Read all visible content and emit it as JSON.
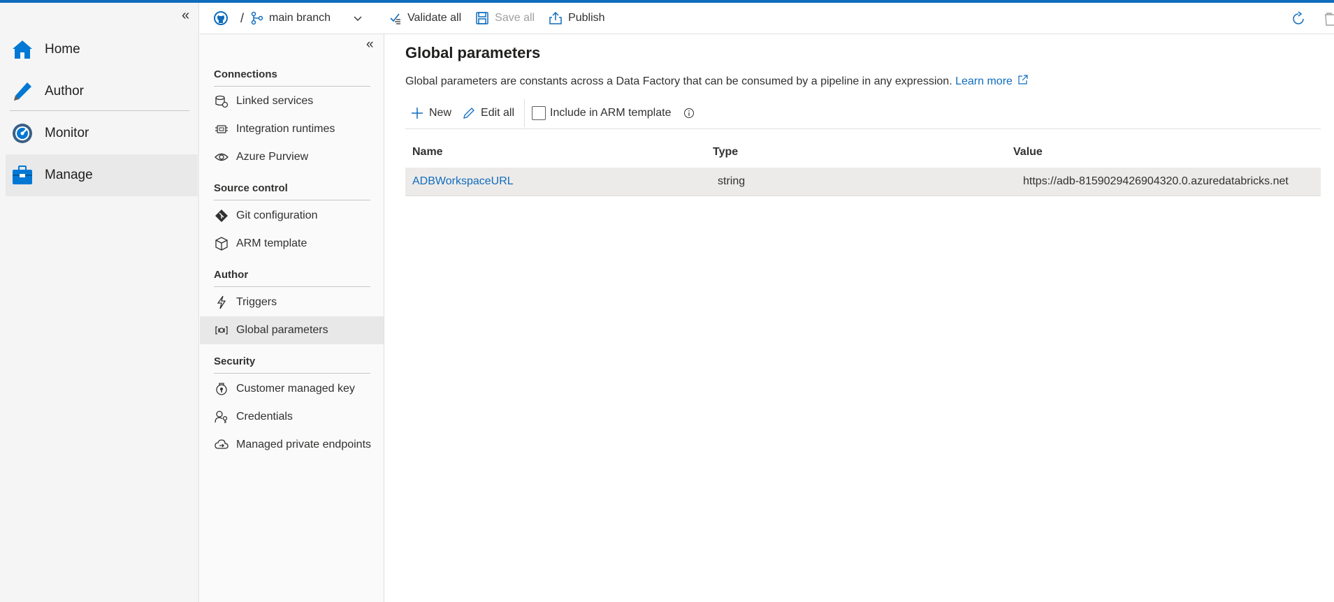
{
  "leftnav": {
    "collapse_glyph": "«",
    "items": [
      {
        "label": "Home",
        "icon": "home-icon"
      },
      {
        "label": "Author",
        "icon": "pencil-icon"
      },
      {
        "label": "Monitor",
        "icon": "monitor-gauge-icon"
      },
      {
        "label": "Manage",
        "icon": "toolbox-icon",
        "active": true
      }
    ]
  },
  "cmdbar": {
    "repo_icon": "github-icon",
    "slash": "/",
    "branch_label": "main branch",
    "validate_label": "Validate all",
    "save_label": "Save all",
    "publish_label": "Publish"
  },
  "midpanel": {
    "collapse_glyph": "«",
    "sections": [
      {
        "heading": "Connections",
        "items": [
          {
            "label": "Linked services",
            "icon": "linked-services-icon"
          },
          {
            "label": "Integration runtimes",
            "icon": "integration-runtime-icon"
          },
          {
            "label": "Azure Purview",
            "icon": "eye-icon"
          }
        ]
      },
      {
        "heading": "Source control",
        "items": [
          {
            "label": "Git configuration",
            "icon": "git-icon"
          },
          {
            "label": "ARM template",
            "icon": "cube-icon"
          }
        ]
      },
      {
        "heading": "Author",
        "items": [
          {
            "label": "Triggers",
            "icon": "lightning-icon"
          },
          {
            "label": "Global parameters",
            "icon": "parameters-icon",
            "active": true
          }
        ]
      },
      {
        "heading": "Security",
        "items": [
          {
            "label": "Customer managed key",
            "icon": "key-lock-icon"
          },
          {
            "label": "Credentials",
            "icon": "credentials-icon"
          },
          {
            "label": "Managed private endpoints",
            "icon": "cloud-endpoint-icon"
          }
        ]
      }
    ]
  },
  "main": {
    "title": "Global parameters",
    "description": "Global parameters are constants across a Data Factory that can be consumed by a pipeline in any expression.",
    "learn_more": "Learn more",
    "toolbar": {
      "new_label": "New",
      "edit_all_label": "Edit all",
      "include_arm_label": "Include in ARM template",
      "include_arm_checked": false
    },
    "table": {
      "columns": [
        "Name",
        "Type",
        "Value"
      ],
      "rows": [
        {
          "name": "ADBWorkspaceURL",
          "type": "string",
          "value": "https://adb-8159029426904320.0.azuredatabricks.net"
        }
      ]
    }
  },
  "colors": {
    "accent": "#0f6cbd",
    "nav_icon_blue": "#0078d4"
  }
}
